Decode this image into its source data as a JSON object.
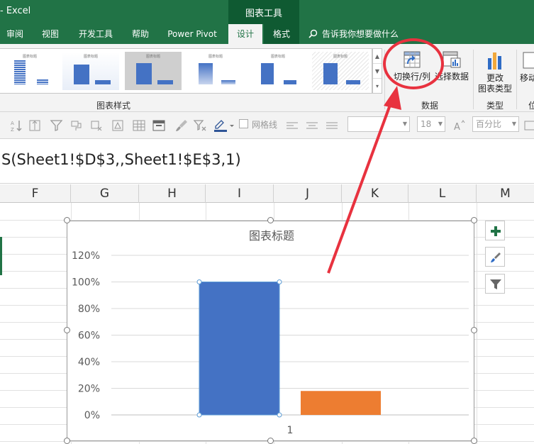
{
  "window": {
    "app_title": "- Excel",
    "context_title": "图表工具"
  },
  "tabs": [
    "审阅",
    "视图",
    "开发工具",
    "帮助",
    "Power Pivot",
    "设计",
    "格式"
  ],
  "active_tab": "设计",
  "tell_me": "告诉我你想要做什么",
  "ribbon": {
    "chart_styles_label": "图表样式",
    "data_group_label": "数据",
    "type_group_label": "类型",
    "switch_row_col": "切换行/列",
    "select_data": "选择数据",
    "change_type_line1": "更改",
    "change_type_line2": "图表类型",
    "move_chart": "移动",
    "edge_label": "位",
    "gallery_captions": [
      "图表标题",
      "图表标题",
      "图表标题",
      "图表标题",
      "图表标题",
      "图表标题"
    ]
  },
  "format_bar": {
    "gridlines_label": "网格线",
    "font_size": "18",
    "number_format": "百分比"
  },
  "formula": {
    "text": "S(Sheet1!$D$3,,Sheet1!$E$3,1)"
  },
  "columns": [
    "F",
    "G",
    "H",
    "I",
    "J",
    "K",
    "L",
    "M"
  ],
  "chart_data": {
    "type": "bar",
    "title": "图表标题",
    "categories": [
      "1"
    ],
    "series": [
      {
        "values": [
          1.0
        ],
        "color": "#4472c4"
      },
      {
        "values": [
          0.18
        ],
        "color": "#ed7d31"
      }
    ],
    "ylim": [
      0,
      1.2
    ],
    "yticks": [
      "0%",
      "20%",
      "40%",
      "60%",
      "80%",
      "100%",
      "120%"
    ],
    "grid": true,
    "legend": "none"
  },
  "colors": {
    "excel_green": "#217346",
    "annotation_red": "#e8323f"
  }
}
